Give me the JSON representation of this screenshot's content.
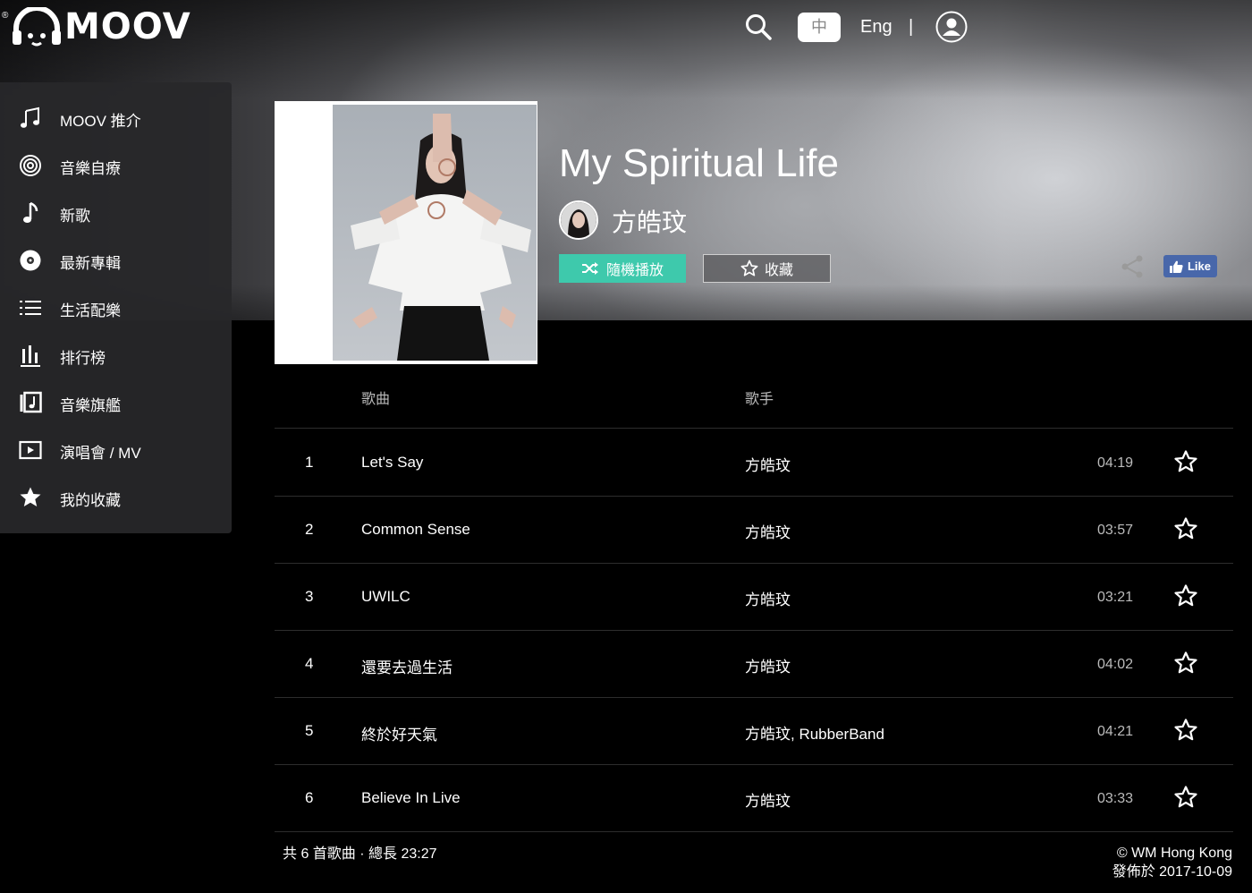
{
  "header": {
    "logo_text": "MOOV",
    "logo_reg": "®",
    "lang_zh": "中",
    "lang_en": "Eng",
    "lang_sep": "|"
  },
  "sidebar": {
    "items": [
      {
        "label": "MOOV 推介",
        "icon": "music-note-icon"
      },
      {
        "label": "音樂自療",
        "icon": "spiral-icon"
      },
      {
        "label": "新歌",
        "icon": "single-note-icon"
      },
      {
        "label": "最新專輯",
        "icon": "disc-icon"
      },
      {
        "label": "生活配樂",
        "icon": "list-icon"
      },
      {
        "label": "排行榜",
        "icon": "chart-bars-icon"
      },
      {
        "label": "音樂旗艦",
        "icon": "music-album-icon"
      },
      {
        "label": "演唱會 / MV",
        "icon": "video-icon"
      },
      {
        "label": "我的收藏",
        "icon": "star-icon"
      }
    ]
  },
  "album": {
    "title": "My Spiritual Life",
    "artist": "方皓玟",
    "shuffle_label": "隨機播放",
    "favorite_label": "收藏",
    "fb_like_label": "Like"
  },
  "table": {
    "col_song": "歌曲",
    "col_artist": "歌手",
    "tracks": [
      {
        "no": "1",
        "title": "Let's Say",
        "artist": "方皓玟",
        "duration": "04:19"
      },
      {
        "no": "2",
        "title": "Common Sense",
        "artist": "方皓玟",
        "duration": "03:57"
      },
      {
        "no": "3",
        "title": "UWILC",
        "artist": "方皓玟",
        "duration": "03:21"
      },
      {
        "no": "4",
        "title": "還要去過生活",
        "artist": "方皓玟",
        "duration": "04:02"
      },
      {
        "no": "5",
        "title": "終於好天氣",
        "artist": "方皓玟, RubberBand",
        "duration": "04:21"
      },
      {
        "no": "6",
        "title": "Believe In Live",
        "artist": "方皓玟",
        "duration": "03:33"
      }
    ]
  },
  "footer": {
    "summary": "共 6 首歌曲 · 總長 23:27",
    "copyright": "© WM Hong Kong",
    "release": "發佈於 2017-10-09"
  },
  "colors": {
    "accent": "#3ec9ac",
    "fb": "#4867aa",
    "background": "#000000",
    "sidebar": "#28282a"
  }
}
